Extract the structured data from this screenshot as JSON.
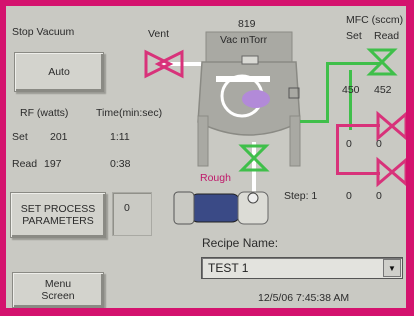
{
  "controls": {
    "stop_vacuum_label": "Stop Vacuum",
    "auto_label": "Auto",
    "set_process_label_1": "SET PROCESS",
    "set_process_label_2": "PARAMETERS",
    "menu_label_1": "Menu",
    "menu_label_2": "Screen"
  },
  "rf": {
    "watts_header": "RF (watts)",
    "time_header": "Time(min:sec)",
    "set_label": "Set",
    "set_watts": "201",
    "set_time": "1:11",
    "read_label": "Read",
    "read_watts": "197",
    "read_time": "0:38"
  },
  "process_param_value": "0",
  "chamber": {
    "vent_label": "Vent",
    "pressure_value": "819",
    "pressure_label": "Vac mTorr",
    "rough_label": "Rough",
    "step_label": "Step: 1",
    "step_values": [
      "0",
      "0"
    ]
  },
  "mfc": {
    "header": "MFC (sccm)",
    "set_label": "Set",
    "read_label": "Read",
    "rows": [
      {
        "set": "450",
        "read": "452"
      },
      {
        "set": "0",
        "read": "0"
      }
    ]
  },
  "recipe": {
    "label": "Recipe Name:",
    "selected": "TEST 1"
  },
  "timestamp": "12/5/06 7:45:38 AM",
  "colors": {
    "frame": "#d4126e",
    "valve_open": "#3fbf4a",
    "valve_closed": "#d8327a",
    "plasma": "#b28ad8",
    "chamber": "#a7a7a1"
  }
}
